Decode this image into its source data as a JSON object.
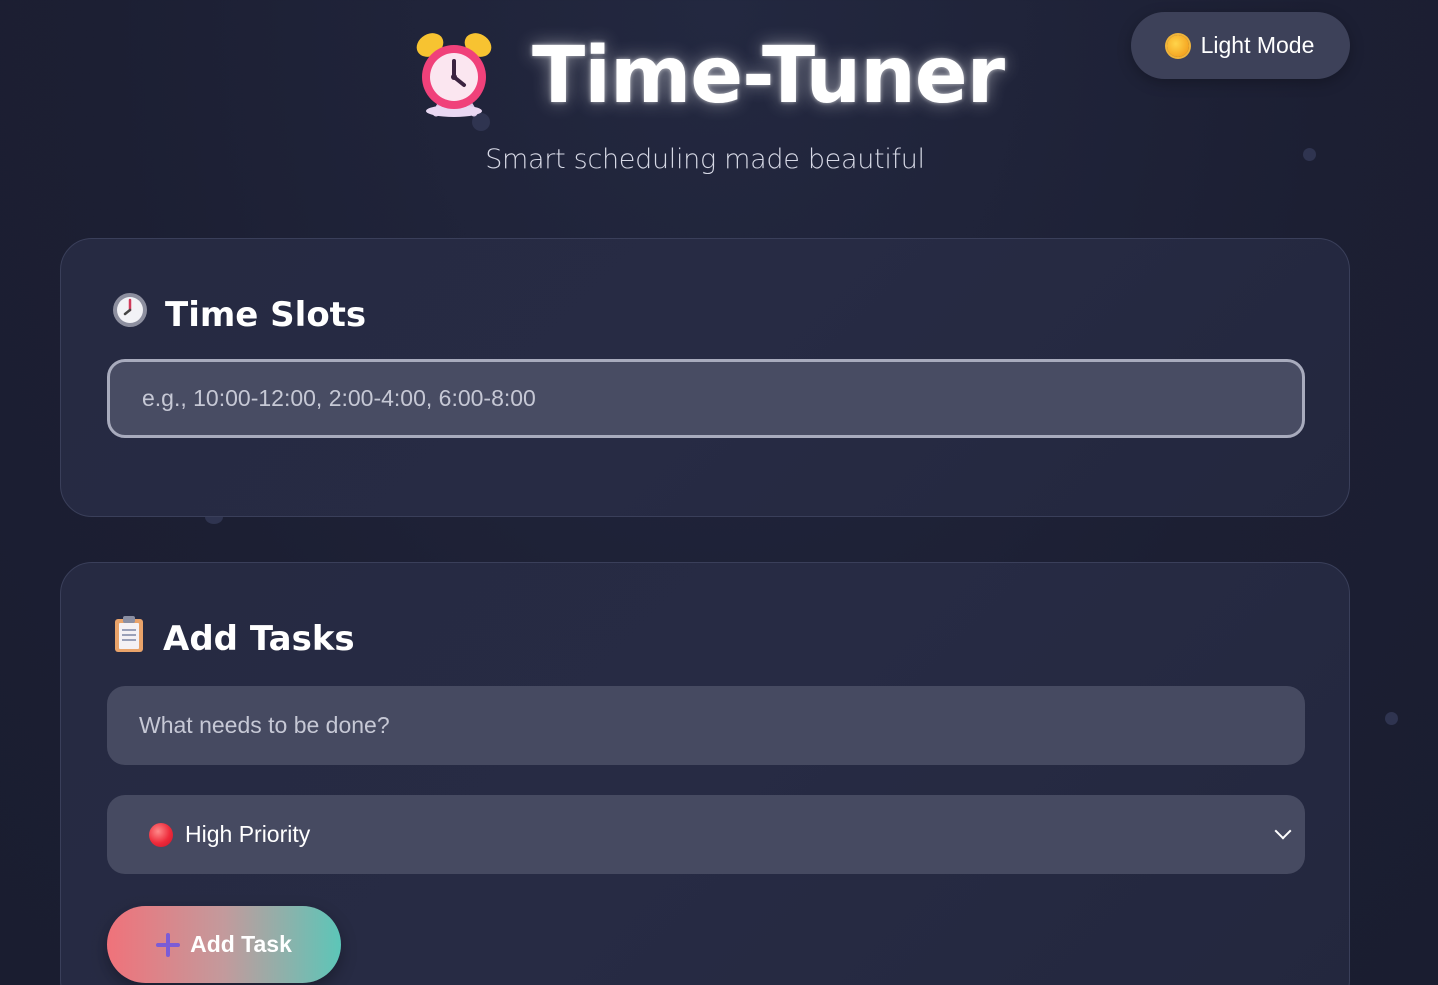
{
  "header": {
    "title": "Time-Tuner",
    "subtitle": "Smart scheduling made beautiful",
    "title_icon": "alarm-clock-icon"
  },
  "theme_toggle": {
    "label": "Light Mode",
    "icon": "sun-icon"
  },
  "time_slots": {
    "title": "Time Slots",
    "icon": "clock-icon",
    "input_placeholder": "e.g., 10:00-12:00, 2:00-4:00, 6:00-8:00",
    "input_value": ""
  },
  "add_tasks": {
    "title": "Add Tasks",
    "icon": "clipboard-icon",
    "task_placeholder": "What needs to be done?",
    "task_value": "",
    "priority_selected": "High Priority",
    "priority_icon": "red-circle-icon",
    "add_button_label": "Add Task",
    "add_button_icon": "plus-icon"
  },
  "colors": {
    "background": "#1d2136",
    "card": "#262a42",
    "field": "#464a61",
    "button_gradient_start": "#f0727a",
    "button_gradient_end": "#5cc6b8"
  }
}
